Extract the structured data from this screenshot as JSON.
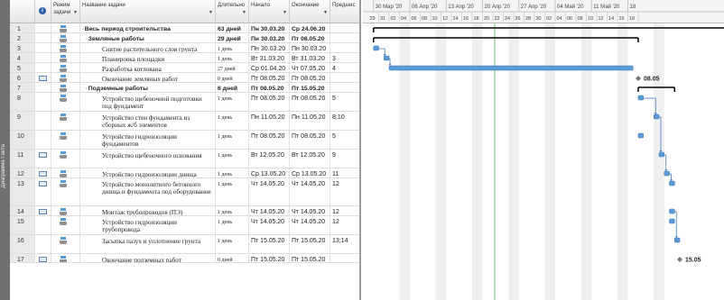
{
  "sidebar": {
    "view_label": "Диаграмма Ганта"
  },
  "columns": {
    "mode": "Режим задачи",
    "name": "Название задачи",
    "duration": "Длительно",
    "start": "Начало",
    "finish": "Окончание",
    "predecessors": "Предшес"
  },
  "rows": [
    {
      "id": "1",
      "name": "Весь период строительства",
      "duration": "63 дней",
      "start": "Пн 30.03.20",
      "finish": "Ср 24.06.20",
      "pred": "",
      "level": 0,
      "summary": true,
      "toggle": "▫",
      "indicator": false
    },
    {
      "id": "2",
      "name": "Земляные работы",
      "duration": "29 дней",
      "start": "Пн 30.03.20",
      "finish": "Пт 08.05.20",
      "pred": "",
      "level": 1,
      "summary": true,
      "toggle": "▫",
      "indicator": false
    },
    {
      "id": "3",
      "name": "Снятие растительного слоя грунта",
      "duration": "1 день",
      "start": "Пн 30.03.20",
      "finish": "Пн 30.03.20",
      "pred": "",
      "level": 2,
      "summary": false,
      "indicator": false
    },
    {
      "id": "4",
      "name": "Планировка площадки",
      "duration": "1 день",
      "start": "Вт 31.03.20",
      "finish": "Вт 31.03.20",
      "pred": "3",
      "level": 2,
      "summary": false,
      "indicator": false
    },
    {
      "id": "5",
      "name": "Разработка котлована",
      "duration": "27 дней",
      "start": "Ср 01.04.20",
      "finish": "Чт 07.05.20",
      "pred": "4",
      "level": 2,
      "summary": false,
      "indicator": false
    },
    {
      "id": "6",
      "name": "Окончание земляных работ",
      "duration": "0 дней",
      "start": "Пт 08.05.20",
      "finish": "Пт 08.05.20",
      "pred": "",
      "level": 2,
      "summary": false,
      "indicator": true
    },
    {
      "id": "7",
      "name": "Подземные работы",
      "duration": "6 дней",
      "start": "Пт 08.05.20",
      "finish": "Пт 15.05.20",
      "pred": "",
      "level": 1,
      "summary": true,
      "toggle": "▫",
      "indicator": false
    },
    {
      "id": "8",
      "name": "Устройство щебеночной подготовки под фундамент",
      "duration": "1 день",
      "start": "Пт 08.05.20",
      "finish": "Пт 08.05.20",
      "pred": "5",
      "level": 2,
      "summary": false,
      "indicator": false
    },
    {
      "id": "9",
      "name": "Устройство стен фундамента из сборных ж/б элементов",
      "duration": "1 день",
      "start": "Пн 11.05.20",
      "finish": "Пн 11.05.20",
      "pred": "8;10",
      "level": 2,
      "summary": false,
      "indicator": false
    },
    {
      "id": "10",
      "name": "Устройство гидроизоляции фундаментов",
      "duration": "1 день",
      "start": "Пт 08.05.20",
      "finish": "Пт 08.05.20",
      "pred": "5",
      "level": 2,
      "summary": false,
      "indicator": false
    },
    {
      "id": "11",
      "name": "Устройство щебеночного основания",
      "duration": "1 день",
      "start": "Вт 12.05.20",
      "finish": "Вт 12.05.20",
      "pred": "9",
      "level": 2,
      "summary": false,
      "indicator": true
    },
    {
      "id": "12",
      "name": "Устройство гидроизоляции днища",
      "duration": "1 день",
      "start": "Ср 13.05.20",
      "finish": "Ср 13.05.20",
      "pred": "11",
      "level": 2,
      "summary": false,
      "indicator": true
    },
    {
      "id": "13",
      "name": "Устройство монолитного бетонного днища и фундамента под оборудование",
      "duration": "1 день",
      "start": "Чт 14.05.20",
      "finish": "Чт 14.05.20",
      "pred": "12",
      "level": 2,
      "summary": false,
      "indicator": true
    },
    {
      "id": "14",
      "name": "Монтаж трубопроводов (ПЭ)",
      "duration": "1 день",
      "start": "Чт 14.05.20",
      "finish": "Чт 14.05.20",
      "pred": "12",
      "level": 2,
      "summary": false,
      "indicator": true
    },
    {
      "id": "15",
      "name": "Устройство гидроизоляции трубопровода",
      "duration": "1 день",
      "start": "Чт 14.05.20",
      "finish": "Чт 14.05.20",
      "pred": "12",
      "level": 2,
      "summary": false,
      "indicator": false
    },
    {
      "id": "16",
      "name": "Засыпка пазух и уплотнение грунта",
      "duration": "1 день",
      "start": "Пт 15.05.20",
      "finish": "Пт 15.05.20",
      "pred": "13;14",
      "level": 2,
      "summary": false,
      "indicator": false
    },
    {
      "id": "17",
      "name": "Окончание подземных работ",
      "duration": "0 дней",
      "start": "Пт 15.05.20",
      "finish": "Пт 15.05.20",
      "pred": "",
      "level": 2,
      "summary": false,
      "indicator": true
    }
  ],
  "timescale": {
    "weeks": [
      "30 Мар '20",
      "06 Апр '20",
      "13 Апр '20",
      "20 Апр '20",
      "27 Апр '20",
      "04 Май '20",
      "11 Май '20",
      "18"
    ],
    "days": [
      "29",
      "31",
      "02",
      "04",
      "06",
      "08",
      "10",
      "12",
      "14",
      "16",
      "18",
      "20",
      "22",
      "24",
      "26",
      "28",
      "30",
      "02",
      "04",
      "06",
      "08",
      "10",
      "12",
      "14",
      "16",
      "18"
    ]
  },
  "milestones": {
    "earthworks_end": "08.05",
    "underground_end": "15.05"
  },
  "colors": {
    "bar": "#5b9bd5",
    "summary": "#000000",
    "link": "#4a7fc1",
    "today": "#73c47a",
    "weekend": "#efefef"
  }
}
